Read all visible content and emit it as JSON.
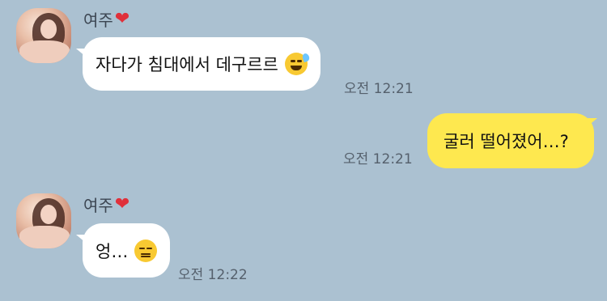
{
  "messages": [
    {
      "sender": "여주",
      "heart_icon": "red-heart-icon",
      "text": "자다가 침대에서 데구르르",
      "emoji_icon": "grinning-sweat-emoji-icon",
      "time": "오전 12:21"
    },
    {
      "text": "굴러 떨어졌어…?",
      "time": "오전 12:21"
    },
    {
      "sender": "여주",
      "heart_icon": "red-heart-icon",
      "text": "엉…",
      "emoji_icon": "expressionless-emoji-icon",
      "time": "오전 12:22"
    }
  ],
  "colors": {
    "background": "#abc1d1",
    "incoming_bubble": "#ffffff",
    "outgoing_bubble": "#fee84f",
    "heart": "#e0303a"
  }
}
